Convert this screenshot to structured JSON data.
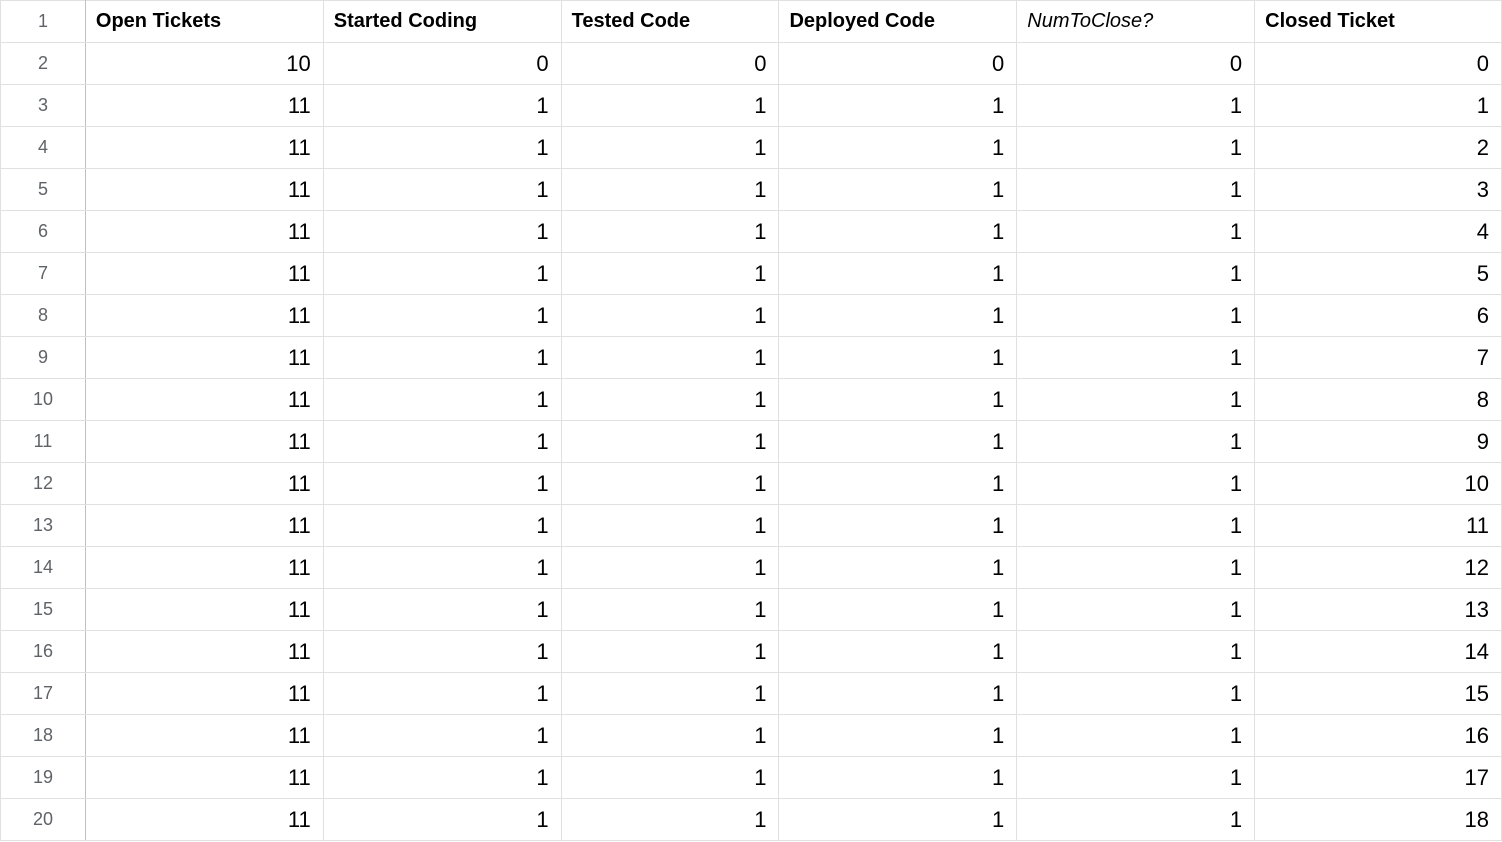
{
  "headers": [
    {
      "label": "Open Tickets",
      "italic": false
    },
    {
      "label": "Started Coding",
      "italic": false
    },
    {
      "label": "Tested Code",
      "italic": false
    },
    {
      "label": "Deployed Code",
      "italic": false
    },
    {
      "label": "NumToClose?",
      "italic": true
    },
    {
      "label": "Closed Ticket",
      "italic": false
    }
  ],
  "rowNumbers": [
    1,
    2,
    3,
    4,
    5,
    6,
    7,
    8,
    9,
    10,
    11,
    12,
    13,
    14,
    15,
    16,
    17,
    18,
    19,
    20
  ],
  "rows": [
    [
      10,
      0,
      0,
      0,
      0,
      0
    ],
    [
      11,
      1,
      1,
      1,
      1,
      1
    ],
    [
      11,
      1,
      1,
      1,
      1,
      2
    ],
    [
      11,
      1,
      1,
      1,
      1,
      3
    ],
    [
      11,
      1,
      1,
      1,
      1,
      4
    ],
    [
      11,
      1,
      1,
      1,
      1,
      5
    ],
    [
      11,
      1,
      1,
      1,
      1,
      6
    ],
    [
      11,
      1,
      1,
      1,
      1,
      7
    ],
    [
      11,
      1,
      1,
      1,
      1,
      8
    ],
    [
      11,
      1,
      1,
      1,
      1,
      9
    ],
    [
      11,
      1,
      1,
      1,
      1,
      10
    ],
    [
      11,
      1,
      1,
      1,
      1,
      11
    ],
    [
      11,
      1,
      1,
      1,
      1,
      12
    ],
    [
      11,
      1,
      1,
      1,
      1,
      13
    ],
    [
      11,
      1,
      1,
      1,
      1,
      14
    ],
    [
      11,
      1,
      1,
      1,
      1,
      15
    ],
    [
      11,
      1,
      1,
      1,
      1,
      16
    ],
    [
      11,
      1,
      1,
      1,
      1,
      17
    ],
    [
      11,
      1,
      1,
      1,
      1,
      18
    ]
  ],
  "colClasses": [
    "col-a",
    "col-b",
    "col-c",
    "col-d",
    "col-e",
    "col-f"
  ]
}
